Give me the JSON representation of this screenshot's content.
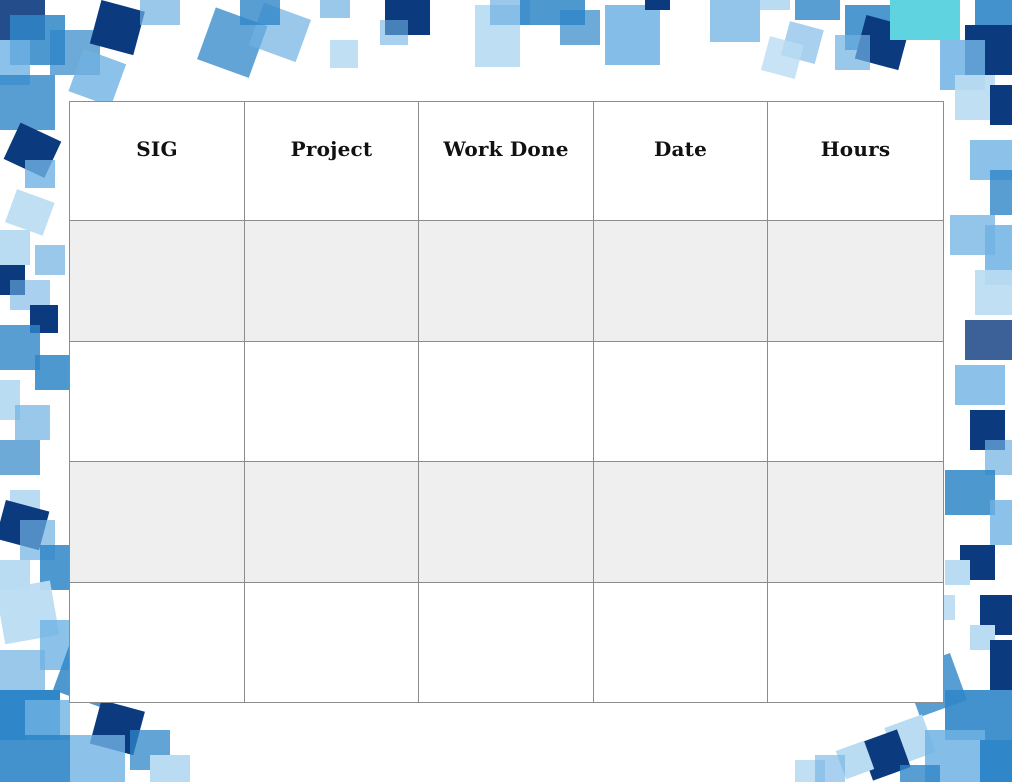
{
  "log_table": {
    "columns": [
      "SIG",
      "Project",
      "Work Done",
      "Date",
      "Hours"
    ],
    "rows": [
      [
        "",
        "",
        "",
        "",
        ""
      ],
      [
        "",
        "",
        "",
        "",
        ""
      ],
      [
        "",
        "",
        "",
        "",
        ""
      ],
      [
        "",
        "",
        "",
        "",
        ""
      ]
    ]
  },
  "colors": {
    "navy": "#0b3a7e",
    "blue": "#2f86c8",
    "sky": "#6fb1e3",
    "pale": "#b9dcf2",
    "cyan": "#5fd3e0",
    "row_shade": "#efefef",
    "grid_line": "#8c8c8c"
  }
}
